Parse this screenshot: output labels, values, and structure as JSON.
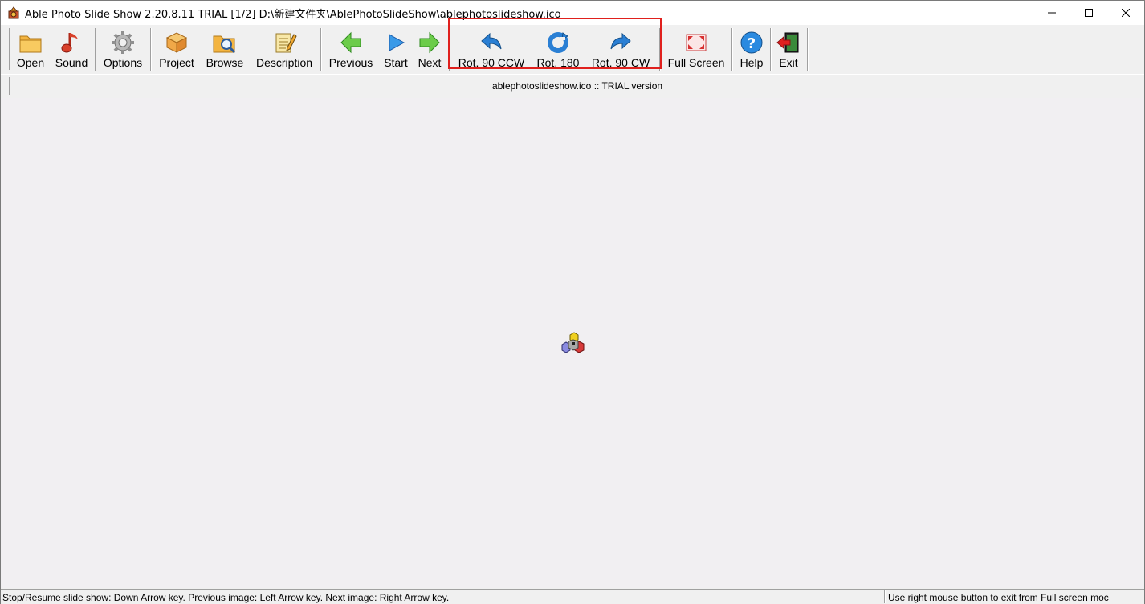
{
  "window": {
    "title": "Able Photo Slide Show 2.20.8.11 TRIAL  [1/2] D:\\新建文件夹\\AblePhotoSlideShow\\ablephotoslideshow.ico"
  },
  "toolbar": {
    "open": "Open",
    "sound": "Sound",
    "options": "Options",
    "project": "Project",
    "browse": "Browse",
    "description": "Description",
    "previous": "Previous",
    "start": "Start",
    "next": "Next",
    "rot_ccw": "Rot. 90 CCW",
    "rot_180": "Rot. 180",
    "rot_cw": "Rot. 90 CW",
    "full_screen": "Full Screen",
    "help": "Help",
    "exit": "Exit"
  },
  "info_bar": {
    "text": "ablephotoslideshow.ico :: TRIAL version"
  },
  "status_bar": {
    "left": "Stop/Resume slide show: Down Arrow key. Previous image: Left Arrow key. Next image: Right Arrow key.",
    "right": "Use right mouse button to exit from Full screen moc"
  },
  "colors": {
    "highlight": "#e0201d",
    "accent_blue": "#2a7fd4",
    "accent_green": "#4cb84a",
    "canvas": "#f1eff2"
  }
}
